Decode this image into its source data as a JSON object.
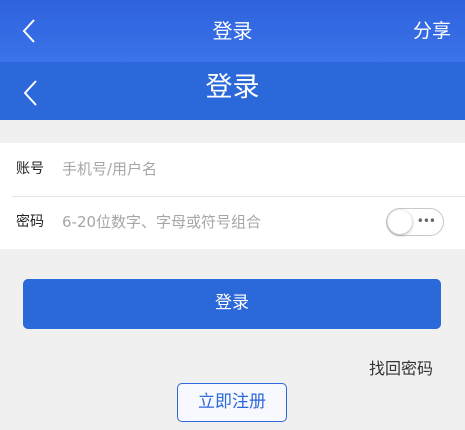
{
  "outer_header": {
    "title": "登录",
    "share_label": "分享",
    "back_icon": "chevron-left-icon"
  },
  "inner_header": {
    "title": "登录",
    "back_icon": "chevron-left-icon"
  },
  "form": {
    "account": {
      "label": "账号",
      "placeholder": "手机号/用户名",
      "value": ""
    },
    "password": {
      "label": "密码",
      "placeholder": "6-20位数字、字母或符号组合",
      "value": "",
      "visibility_toggle_icon": "more-dots-icon",
      "visibility_toggle_on": false
    }
  },
  "actions": {
    "login_label": "登录",
    "forgot_label": "找回密码",
    "register_label": "立即注册"
  },
  "colors": {
    "primary": "#2b68da",
    "background": "#f0f0f0"
  }
}
